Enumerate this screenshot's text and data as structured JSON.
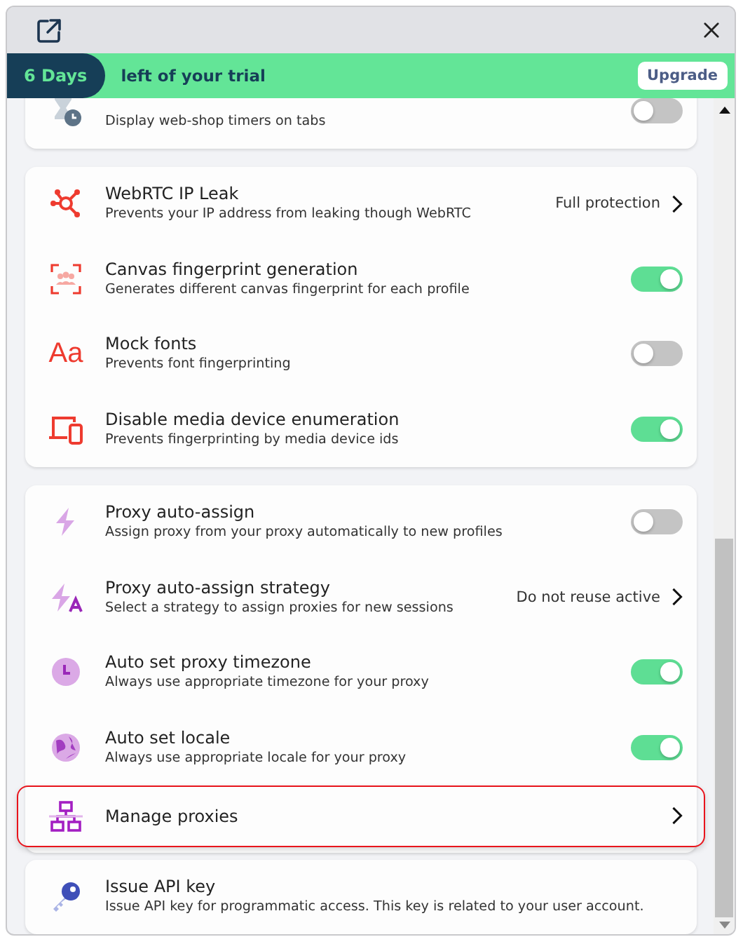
{
  "banner": {
    "days": "6 Days",
    "text": "left of your trial",
    "button": "Upgrade"
  },
  "sections": [
    {
      "rows": [
        {
          "kind": "toggle",
          "description": "Display web-shop timers on tabs",
          "on": false
        }
      ]
    },
    {
      "rows": [
        {
          "kind": "choice",
          "title": "WebRTC IP Leak",
          "description": "Prevents your IP address from leaking though WebRTC",
          "value": "Full protection"
        },
        {
          "kind": "toggle",
          "title": "Canvas fingerprint generation",
          "description": "Generates different canvas fingerprint for each profile",
          "on": true
        },
        {
          "kind": "toggle",
          "title": "Mock fonts",
          "description": "Prevents font fingerprinting",
          "on": false,
          "icon_text": "Aa"
        },
        {
          "kind": "toggle",
          "title": "Disable media device enumeration",
          "description": "Prevents fingerprinting by media device ids",
          "on": true
        }
      ]
    },
    {
      "rows": [
        {
          "kind": "toggle",
          "title": "Proxy auto-assign",
          "description": "Assign proxy from your proxy automatically to new profiles",
          "on": false
        },
        {
          "kind": "choice",
          "title": "Proxy auto-assign strategy",
          "description": "Select a strategy to assign proxies for new sessions",
          "value": "Do not reuse active"
        },
        {
          "kind": "toggle",
          "title": "Auto set proxy timezone",
          "description": "Always use appropriate timezone for your proxy",
          "on": true
        },
        {
          "kind": "toggle",
          "title": "Auto set locale",
          "description": "Always use appropriate locale for your proxy",
          "on": true
        },
        {
          "kind": "nav",
          "title": "Manage proxies",
          "highlighted": true
        }
      ]
    },
    {
      "rows": [
        {
          "kind": "info",
          "title": "Issue API key",
          "description": "Issue API key for programmatic access. This key is related to your user account."
        }
      ]
    }
  ]
}
